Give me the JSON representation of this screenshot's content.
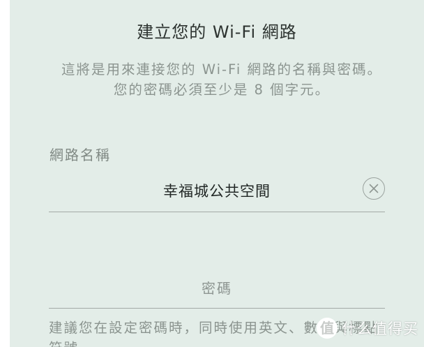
{
  "header": {
    "title": "建立您的 Wi-Fi 網路"
  },
  "description": "這將是用來連接您的 Wi-Fi 網路的名稱與密碼。您的密碼必須至少是 8 個字元。",
  "network_name": {
    "label": "網路名稱",
    "value": "幸福城公共空間",
    "clear_icon": "close-circle-icon"
  },
  "password": {
    "placeholder": "密碼",
    "value": ""
  },
  "hint": "建議您在設定密碼時，同時使用英文、數字與標點符號。",
  "watermark": {
    "logo_char": "值",
    "text": "什么值得买"
  },
  "colors": {
    "background": "#e3ede8",
    "title": "#2d3330",
    "muted_text": "#8b948f",
    "underline": "#a3aaa6"
  }
}
